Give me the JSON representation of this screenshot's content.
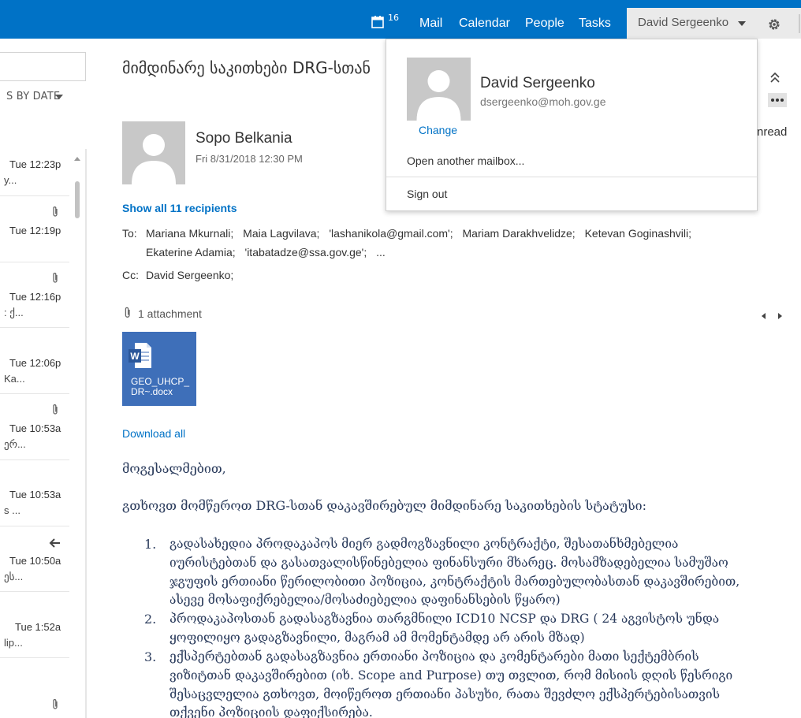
{
  "topbar": {
    "calendar_badge": "16",
    "nav": {
      "mail": "Mail",
      "calendar": "Calendar",
      "people": "People",
      "tasks": "Tasks"
    },
    "user_name": "David Sergeenko",
    "accent_color": "#0072c6"
  },
  "list": {
    "sort_label": "S BY DATE",
    "items": [
      {
        "time": "Tue 12:23p",
        "preview": "y...",
        "attachment": false
      },
      {
        "time": "Tue 12:19p",
        "preview": "",
        "attachment": true
      },
      {
        "time": "Tue 12:16p",
        "preview": ": ქ...",
        "attachment": true
      },
      {
        "time": "Tue 12:06p",
        "preview": "Ka...",
        "attachment": false
      },
      {
        "time": "Tue 10:53a",
        "preview": "ერ...",
        "attachment": true
      },
      {
        "time": "Tue 10:53a",
        "preview": "s ...",
        "attachment": false
      },
      {
        "time": "Tue 10:50a",
        "preview": "ეს...",
        "attachment": false
      },
      {
        "time": "Tue 1:52a",
        "preview": "lip...",
        "attachment": false
      }
    ]
  },
  "message": {
    "subject": "მიმდინარე საკითხები DRG-სთან",
    "sender": "Sopo Belkania",
    "date": "Fri 8/31/2018 12:30 PM",
    "show_all": "Show all 11 recipients",
    "to_label": "To:",
    "to_line1": [
      "Mariana Mkurnali;",
      "Maia Lagvilava;",
      "'lashanikola@gmail.com';",
      "Mariam Darakhvelidze;",
      "Ketevan Goginashvili;"
    ],
    "to_line2": [
      "Ekaterine Adamia;",
      "'itabatadze@ssa.gov.ge';",
      "..."
    ],
    "cc_label": "Cc:",
    "cc": "David Sergeenko;",
    "attachment_count": "1 attachment",
    "attachment_name_1": "GEO_UHCP_",
    "attachment_name_2": "DR~.docx",
    "download_all": "Download all",
    "unread_label": "nread",
    "greeting": "მოგესალმებით,",
    "intro": "გთხოვთ მომწეროთ DRG-სთან დაკავშირებულ მიმდინარე საკითხების სტატუსი:",
    "items": [
      {
        "num": "1.",
        "lines": [
          "გადასახედია პროდაკაპოს მიერ გადმოგზავნილი კონტრაქტი, შესათანხმებელია",
          "იურისტებთან და გასათვალისწინებელია ფინანსური მხარეც. მოსამზადებელია სამუშაო",
          "ჯგუფის ერთიანი წერილობითი პოზიცია, კონტრაქტის მართებულობასთან დაკავშირებით,",
          "ასევე მოსაფიქრებელია/მოსაძიებელია დაფინანსების წყარო)"
        ]
      },
      {
        "num": "2.",
        "lines": [
          "პროდაკაპოსთან გადასაგზავნია თარგმნილი ICD10 NCSP და DRG ( 24 აგვისტოს უნდა",
          "ყოფილიყო გადაგზავნილი, მაგრამ ამ მომენტამდე არ არის მზად)"
        ]
      },
      {
        "num": "3.",
        "lines": [
          "ექსპერტებთან გადასაგზავნია ერთიანი პოზიცია და კომენტარები მათი სექტემბრის",
          "ვიზიტთან დაკავშირებით (იხ. Scope and Purpose) თუ თვლით, რომ მისიის დღის წესრიგი",
          "შესაცვლელია გთხოვთ, მოიწეროთ ერთიანი პასუხი, რათა შევძლო ექსპერტებისათვის",
          "თქვენი პოზიციის დაფიქსირება."
        ]
      }
    ]
  },
  "dropdown": {
    "name": "David Sergeenko",
    "email": "dsergeenko@moh.gov.ge",
    "change": "Change",
    "open_another": "Open another mailbox...",
    "sign_out": "Sign out"
  }
}
